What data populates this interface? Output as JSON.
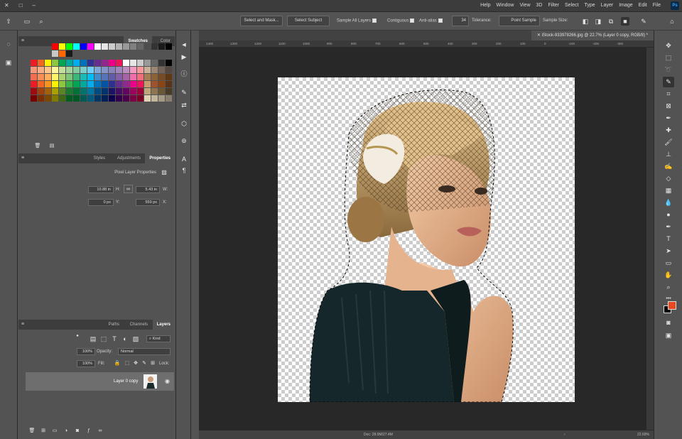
{
  "menubar": {
    "app_logo": "Ps",
    "items": [
      "File",
      "Edit",
      "Image",
      "Layer",
      "Type",
      "Select",
      "Filter",
      "3D",
      "View",
      "Window",
      "Help"
    ],
    "window_controls": [
      "–",
      "□",
      "✕"
    ]
  },
  "options": {
    "tool_icon": "quick-selection-icon",
    "home_icon": "home-icon",
    "sample_size_label": "Sample Size:",
    "sample_size_value": "Point Sample",
    "tolerance_label": "Tolerance:",
    "tolerance_value": "34",
    "anti_alias": "Anti-alias",
    "contiguous": "Contiguous",
    "sample_all_layers": "Sample All Layers",
    "select_subject": "Select Subject",
    "select_and_mask": "Select and Mask..."
  },
  "document": {
    "tab_title": "iStock-933978266.jpg @ 22.7% (Layer 0 copy, RGB/8) *",
    "ruler_ticks": [
      "-300",
      "-200",
      "-100",
      "0",
      "100",
      "200",
      "300",
      "400",
      "500",
      "600",
      "700",
      "800",
      "900",
      "1000",
      "1100",
      "1200",
      "1300",
      "1400"
    ]
  },
  "status": {
    "zoom": "22.69%",
    "doc_info": "Doc: 28.0M/27.4M",
    "arrow": "›"
  },
  "swatches_panel": {
    "tabs": [
      "Swatches",
      "Color"
    ],
    "active": "Swatches",
    "row1": [
      "#ff0000",
      "#ffff00",
      "#00ff00",
      "#00ffff",
      "#0000ff",
      "#ff00ff",
      "#ffffff",
      "#e6e6e6",
      "#cccccc",
      "#b3b3b3",
      "#999999",
      "#808080",
      "#666666",
      "#4d4d4d",
      "#333333",
      "#1a1a1a",
      "#000000",
      "#c7c7c7",
      "#ff6600",
      "#1a1a1a"
    ],
    "rows": [
      [
        "#ed1c24",
        "#f26522",
        "#fff200",
        "#8dc63f",
        "#00a651",
        "#00a99d",
        "#00aeef",
        "#0072bc",
        "#2e3192",
        "#662d91",
        "#92278f",
        "#ec008c",
        "#ed145b",
        "#ffffff",
        "#e6e6e6",
        "#cccccc",
        "#999999",
        "#666666",
        "#333333",
        "#000000"
      ],
      [
        "#f7977a",
        "#f9ad81",
        "#fdc68a",
        "#fff79a",
        "#c4df9b",
        "#a3d39c",
        "#82ca9d",
        "#7bcdc8",
        "#6ecff6",
        "#7ea7d8",
        "#8493ca",
        "#8882be",
        "#a187be",
        "#bc8dbf",
        "#f49ac2",
        "#f6989d",
        "#c7b299",
        "#998675",
        "#736357",
        "#534741"
      ],
      [
        "#f26c4f",
        "#f68e55",
        "#fbaf5c",
        "#fff467",
        "#acd372",
        "#7cc576",
        "#3bb878",
        "#1abbb4",
        "#00bff3",
        "#438ccb",
        "#5574b9",
        "#605ca8",
        "#855fa8",
        "#a763a8",
        "#f06ea9",
        "#f26d7d",
        "#a67c52",
        "#8c6239",
        "#754c24",
        "#603913"
      ],
      [
        "#ed1c24",
        "#f26522",
        "#f7941d",
        "#fff200",
        "#8dc63f",
        "#39b54a",
        "#00a651",
        "#00a99d",
        "#00aeef",
        "#0072bc",
        "#0054a6",
        "#2e3192",
        "#662d91",
        "#92278f",
        "#ec008c",
        "#ed145b",
        "#c69c6d",
        "#a0522d",
        "#8b4513",
        "#5c3317"
      ],
      [
        "#9e0b0f",
        "#a0410d",
        "#a36209",
        "#aba000",
        "#598527",
        "#1a7b30",
        "#007236",
        "#00746b",
        "#0076a3",
        "#004b80",
        "#003471",
        "#1b1464",
        "#440e62",
        "#630460",
        "#9e005d",
        "#9e0039",
        "#bfa67a",
        "#8e7451",
        "#6b5738",
        "#4a3b26"
      ],
      [
        "#790000",
        "#7b2e00",
        "#7d4900",
        "#827b00",
        "#406618",
        "#005e20",
        "#005826",
        "#005952",
        "#005b7f",
        "#003663",
        "#002157",
        "#0d004c",
        "#32004b",
        "#4b0049",
        "#7b0046",
        "#7a0026",
        "#e0d2b4",
        "#c2b59b",
        "#a69985",
        "#8a7f6f"
      ]
    ]
  },
  "properties_panel": {
    "tabs": [
      "Properties",
      "Adjustments",
      "Styles"
    ],
    "active": "Properties",
    "header": "Pixel Layer Properties",
    "w_label": "W:",
    "w_value": "5.43 in",
    "h_label": "H:",
    "h_value": "10.88 in",
    "x_label": "X:",
    "x_value": "559 px",
    "y_label": "Y:",
    "y_value": "0 px",
    "link_icon": "link-icon"
  },
  "layers_panel": {
    "tabs": [
      "Layers",
      "Channels",
      "Paths"
    ],
    "active": "Layers",
    "kind_label": "Kind",
    "blend_mode": "Normal",
    "opacity_label": "Opacity:",
    "opacity_value": "100%",
    "lock_label": "Lock:",
    "fill_label": "Fill:",
    "fill_value": "100%",
    "layers": [
      {
        "name": "Layer 0 copy"
      }
    ],
    "bottom_icons": [
      "link-layers-icon",
      "fx-icon",
      "add-mask-icon",
      "adjustment-icon",
      "group-icon",
      "new-layer-icon",
      "delete-icon"
    ]
  },
  "colors": {
    "foreground": "#e8481e",
    "background": "#000000",
    "panel_bg": "#535353",
    "canvas_bg": "#282828"
  }
}
